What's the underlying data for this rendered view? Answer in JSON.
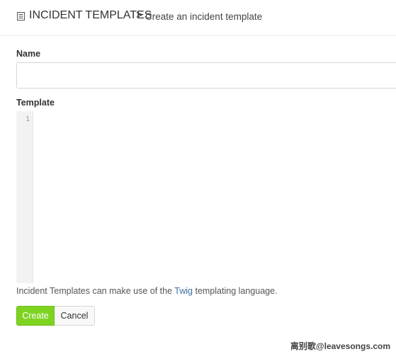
{
  "header": {
    "icon": "document-icon",
    "section_title": "INCIDENT TEMPLATES",
    "separator": ">",
    "sub_title": "Create an incident template"
  },
  "form": {
    "name_label": "Name",
    "name_value": "",
    "template_label": "Template",
    "editor": {
      "line_numbers": [
        "1"
      ],
      "content": ""
    }
  },
  "help": {
    "prefix": "Incident Templates can make use of the ",
    "link_text": "Twig",
    "suffix": " templating language."
  },
  "actions": {
    "create_label": "Create",
    "cancel_label": "Cancel"
  },
  "watermark": "离别歌@leavesongs.com",
  "colors": {
    "create_button": "#7ed321",
    "link": "#3a6ea5"
  }
}
